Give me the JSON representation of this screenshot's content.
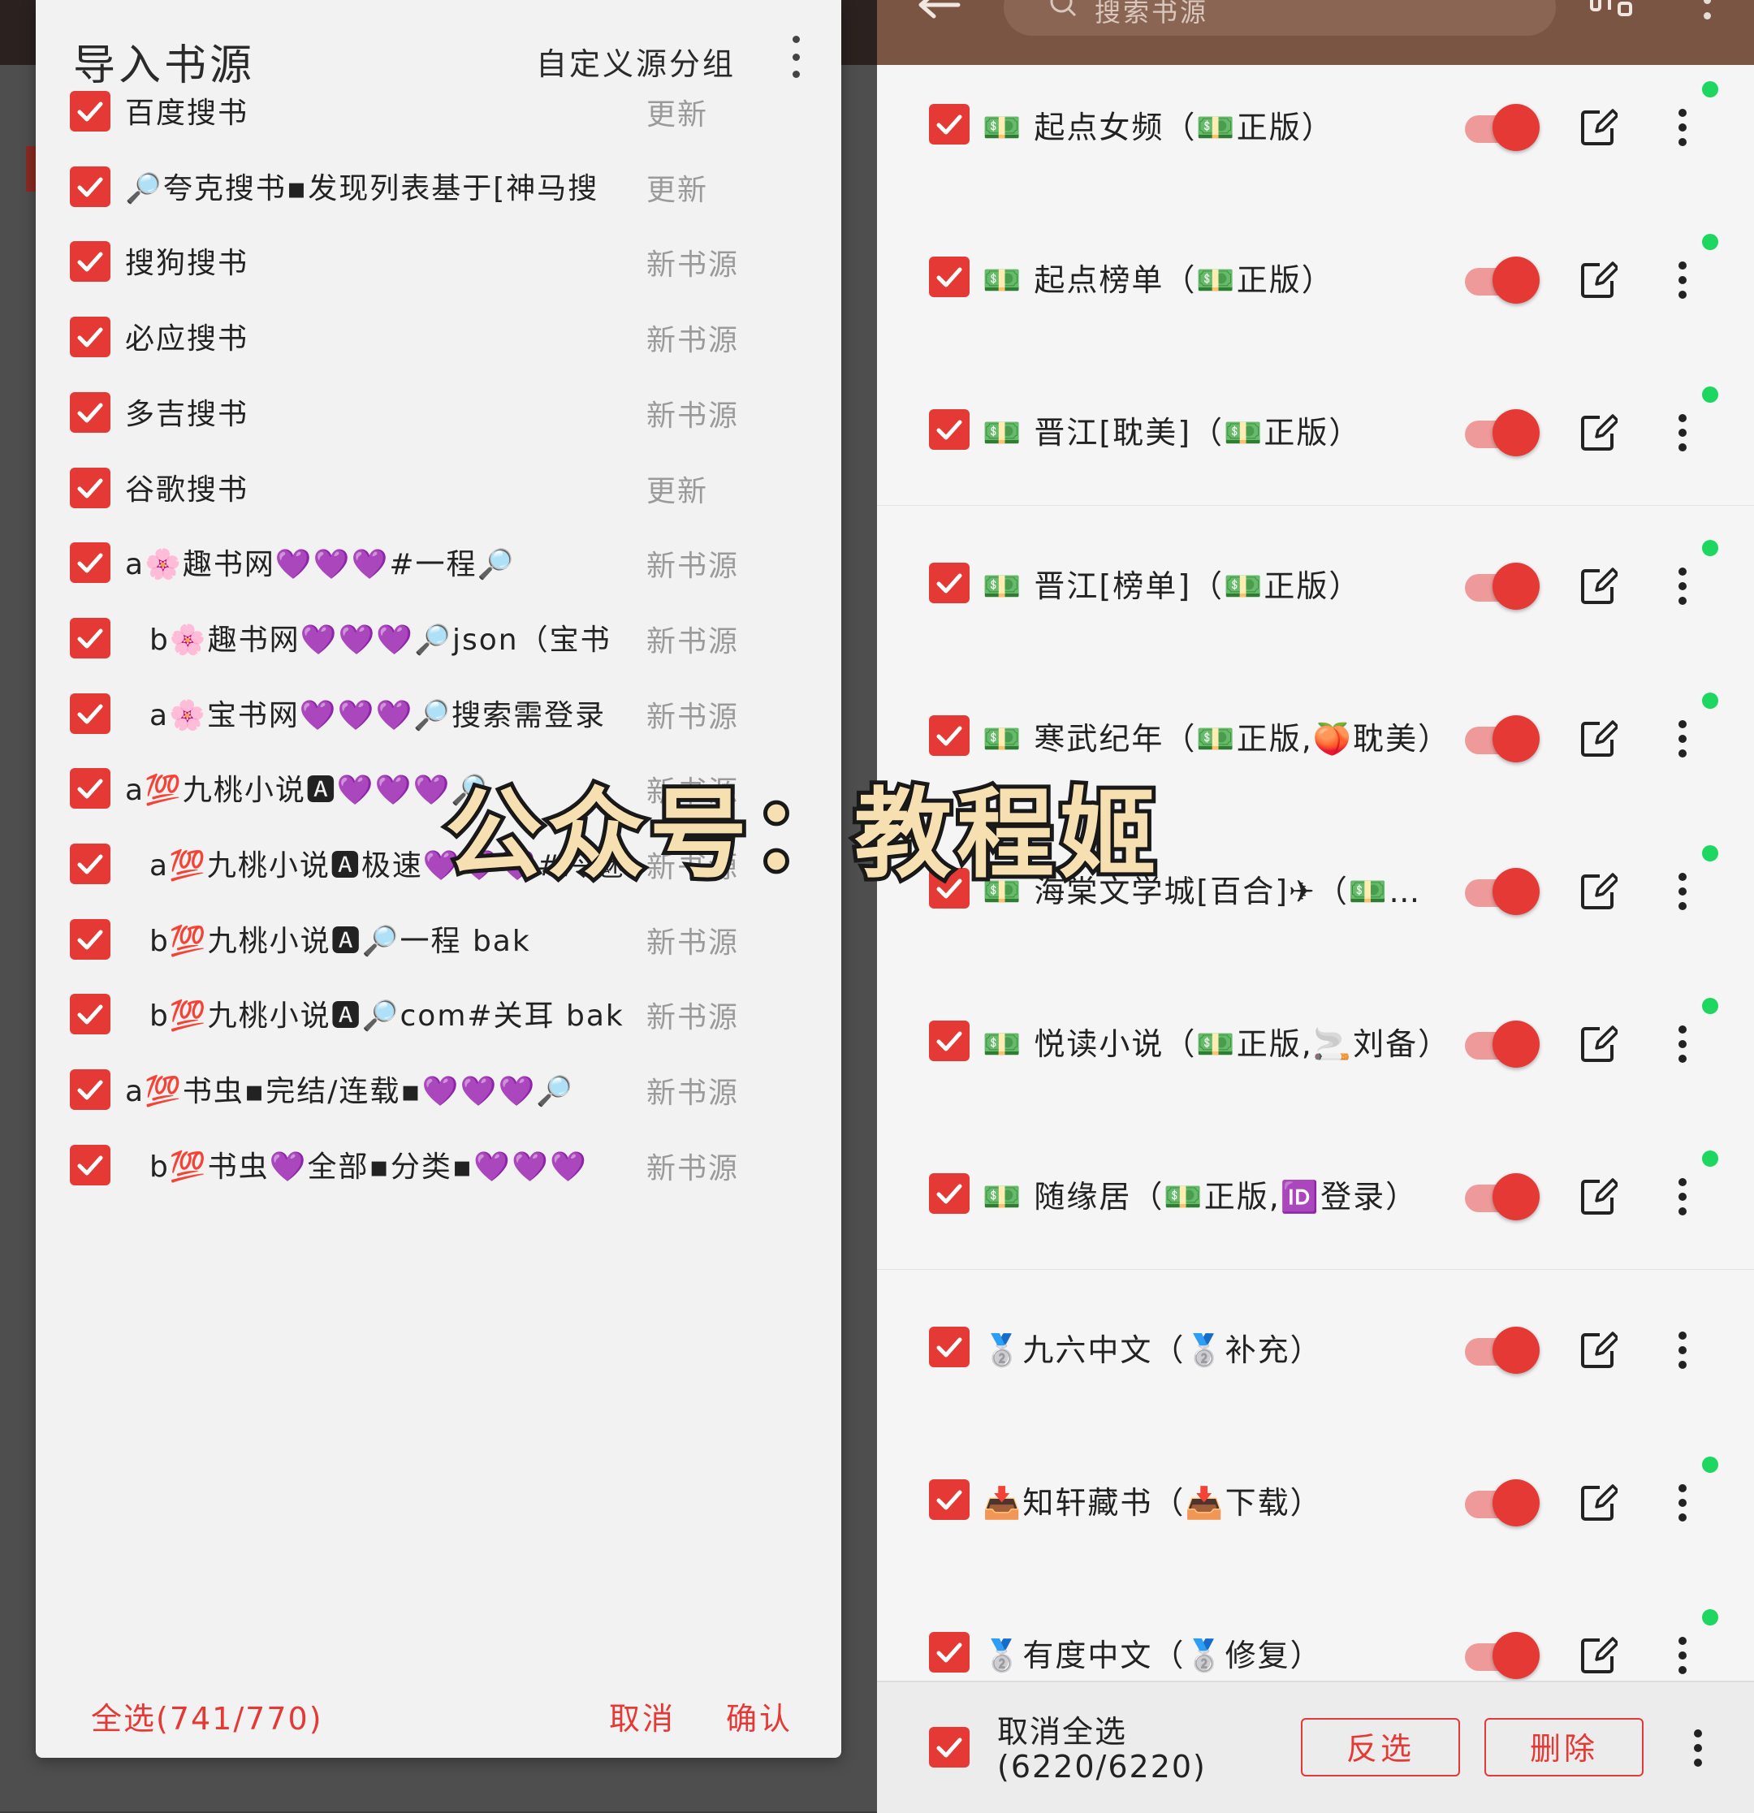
{
  "dialog": {
    "title": "导入书源",
    "group_button": "自定义源分组",
    "select_all": "全选(741/770)",
    "cancel": "取消",
    "confirm": "确认",
    "items": [
      {
        "name": "百度搜书",
        "status": "更新"
      },
      {
        "name": "🔎夸克搜书▪发现列表基于[神马搜",
        "status": "更新"
      },
      {
        "name": "搜狗搜书",
        "status": "新书源"
      },
      {
        "name": "必应搜书",
        "status": "新书源"
      },
      {
        "name": "多吉搜书",
        "status": "新书源"
      },
      {
        "name": "谷歌搜书",
        "status": "更新"
      },
      {
        "name": "a🌸趣书网💜💜💜#一程🔎",
        "status": "新书源"
      },
      {
        "name": "b🌸趣书网💜💜💜🔎json（宝书",
        "status": "新书源"
      },
      {
        "name": "a🌸宝书网💜💜💜🔎搜索需登录",
        "status": "新书源"
      },
      {
        "name": "a💯九桃小说🅰💜💜💜🔎",
        "status": "新书源"
      },
      {
        "name": "a💯九桃小说🅰极速💜💜💜#冷魅",
        "status": "新书源"
      },
      {
        "name": "b💯九桃小说🅰🔎一程 bak",
        "status": "新书源"
      },
      {
        "name": "b💯九桃小说🅰🔎com#关耳 bak",
        "status": "新书源"
      },
      {
        "name": "a💯书虫▪完结/连载▪💜💜💜🔎",
        "status": "新书源"
      },
      {
        "name": "b💯书虫💜全部▪分类▪💜💜💜",
        "status": "新书源"
      }
    ]
  },
  "toolbar": {
    "search_placeholder": "搜索书源"
  },
  "sources": [
    {
      "name": "💵 起点女频（💵正版）",
      "enabled": true,
      "dot": true
    },
    {
      "name": "💵 起点榜单（💵正版）",
      "enabled": true,
      "dot": true
    },
    {
      "name": "💵 晋江[耽美]（💵正版）",
      "enabled": true,
      "dot": true
    },
    {
      "name": "💵 晋江[榜单]（💵正版）",
      "enabled": true,
      "dot": true
    },
    {
      "name": "💵 寒武纪年（💵正版,🍑耽美）",
      "enabled": true,
      "dot": true
    },
    {
      "name": "💵 海棠文学城[百合]✈（💵…",
      "enabled": true,
      "dot": true
    },
    {
      "name": "💵 悦读小说（💵正版,🚬刘备）",
      "enabled": true,
      "dot": true
    },
    {
      "name": "💵 随缘居（💵正版,🆔登录）",
      "enabled": true,
      "dot": true
    },
    {
      "name": "🥈九六中文（🥈补充）",
      "enabled": true,
      "dot": false
    },
    {
      "name": "📥知轩藏书（📥下载）",
      "enabled": true,
      "dot": true
    },
    {
      "name": "🥈有度中文（🥈修复）",
      "enabled": true,
      "dot": true
    }
  ],
  "bottom_bar": {
    "label_line1": "取消全选",
    "label_line2": "(6220/6220)",
    "invert": "反选",
    "delete": "删除"
  },
  "watermark": "公众号：教程姬",
  "colors": {
    "accent": "#e53935",
    "toolbar": "#7a5543",
    "online_dot": "#1ed760"
  }
}
